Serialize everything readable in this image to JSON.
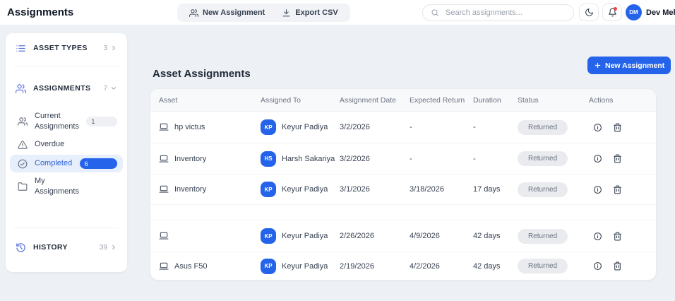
{
  "topbar": {
    "title": "Assignments",
    "new_assignment_label": "New Assignment",
    "export_csv_label": "Export CSV",
    "search_placeholder": "Search assignments...",
    "user": {
      "initials": "DM",
      "name": "Dev Mehta"
    }
  },
  "sidebar": {
    "asset_types": {
      "label": "ASSET TYPES",
      "count": "3",
      "icon": "list-icon"
    },
    "assignments": {
      "label": "ASSIGNMENTS",
      "count": "7",
      "icon": "users-icon"
    },
    "items": [
      {
        "label": "Current Assignments",
        "icon": "users-icon",
        "badge": "1",
        "selected": false
      },
      {
        "label": "Overdue",
        "icon": "warning-icon",
        "badge": "",
        "selected": false
      },
      {
        "label": "Completed",
        "icon": "check-circle-icon",
        "badge": "6",
        "selected": true
      },
      {
        "label": "My Assignments",
        "icon": "folder-icon",
        "badge": "",
        "selected": false
      }
    ],
    "history": {
      "label": "HISTORY",
      "count": "39",
      "icon": "history-icon"
    }
  },
  "main": {
    "heading": "Asset Assignments",
    "new_assignment_button": "New Assignment",
    "table": {
      "columns": [
        "Asset",
        "Assigned To",
        "Assignment Date",
        "Expected Return",
        "Duration",
        "Status",
        "Actions"
      ],
      "rows": [
        {
          "empty": false,
          "asset": "hp victus",
          "assignee_initials": "KP",
          "assignee": "Keyur Padiya",
          "assignment_date": "3/2/2026",
          "expected_return": "-",
          "duration": "-",
          "status": "Returned"
        },
        {
          "empty": false,
          "asset": "Inventory",
          "assignee_initials": "HS",
          "assignee": "Harsh Sakariya",
          "assignment_date": "3/2/2026",
          "expected_return": "-",
          "duration": "-",
          "status": "Returned"
        },
        {
          "empty": false,
          "asset": "Inventory",
          "assignee_initials": "KP",
          "assignee": "Keyur Padiya",
          "assignment_date": "3/1/2026",
          "expected_return": "3/18/2026",
          "duration": "17 days",
          "status": "Returned"
        },
        {
          "empty": true,
          "asset": "",
          "assignee_initials": "",
          "assignee": "",
          "assignment_date": "",
          "expected_return": "",
          "duration": "",
          "status": ""
        },
        {
          "empty": false,
          "asset": "",
          "assignee_initials": "KP",
          "assignee": "Keyur Padiya",
          "assignment_date": "2/26/2026",
          "expected_return": "4/9/2026",
          "duration": "42 days",
          "status": "Returned"
        },
        {
          "empty": false,
          "asset": "Asus F50",
          "assignee_initials": "KP",
          "assignee": "Keyur Padiya",
          "assignment_date": "2/19/2026",
          "expected_return": "4/2/2026",
          "duration": "42 days",
          "status": "Returned"
        }
      ]
    }
  },
  "colors": {
    "accent": "#2563eb",
    "selected_item_bg": "#e8effc",
    "status_pill_bg": "#e9ebee",
    "status_pill_text": "#6b7280",
    "notification_dot": "#ef4444"
  }
}
